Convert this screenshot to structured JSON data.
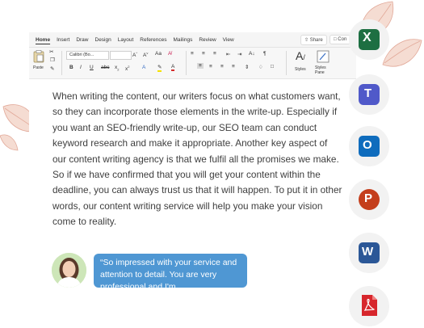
{
  "ribbon": {
    "tabs": [
      "Home",
      "Insert",
      "Draw",
      "Design",
      "Layout",
      "References",
      "Mailings",
      "Review",
      "View"
    ],
    "share_label": "Share",
    "comments_label": "Con",
    "paste_label": "Paste",
    "font_name": "Calibri (Bo...",
    "styles_label": "Styles",
    "styles_pane_label": "Styles Pane"
  },
  "document": {
    "text": "When writing the content, our writers focus on what customers want, so they can incorporate those elements in the write-up. Especially if you want an SEO-friendly write-up, our SEO team can conduct keyword research and make it appropriate. Another key aspect of our content writing agency is that we fulfil all the promises we make. So if we have confirmed that you will get your content within the deadline, you can always trust us that it will happen. To put it in other words, our content writing service will help you make your vision come to reality."
  },
  "testimonial": {
    "text": "“So impressed with your service and attention to detail. You are very professional and I'm"
  },
  "apps": [
    {
      "name": "Excel",
      "letter": "X",
      "color": "#1d6f42"
    },
    {
      "name": "Teams",
      "letter": "T",
      "color": "#5059c9"
    },
    {
      "name": "Outlook",
      "letter": "O",
      "color": "#0f6cbd"
    },
    {
      "name": "PowerPoint",
      "letter": "P",
      "color": "#c43e1c"
    },
    {
      "name": "Word",
      "letter": "W",
      "color": "#2b5797"
    },
    {
      "name": "PDF",
      "letter": "",
      "color": "#d7262c"
    }
  ],
  "colors": {
    "leaf_fill": "#f5dcd2",
    "leaf_stroke": "#e2a999",
    "bubble": "#4f97d3"
  }
}
